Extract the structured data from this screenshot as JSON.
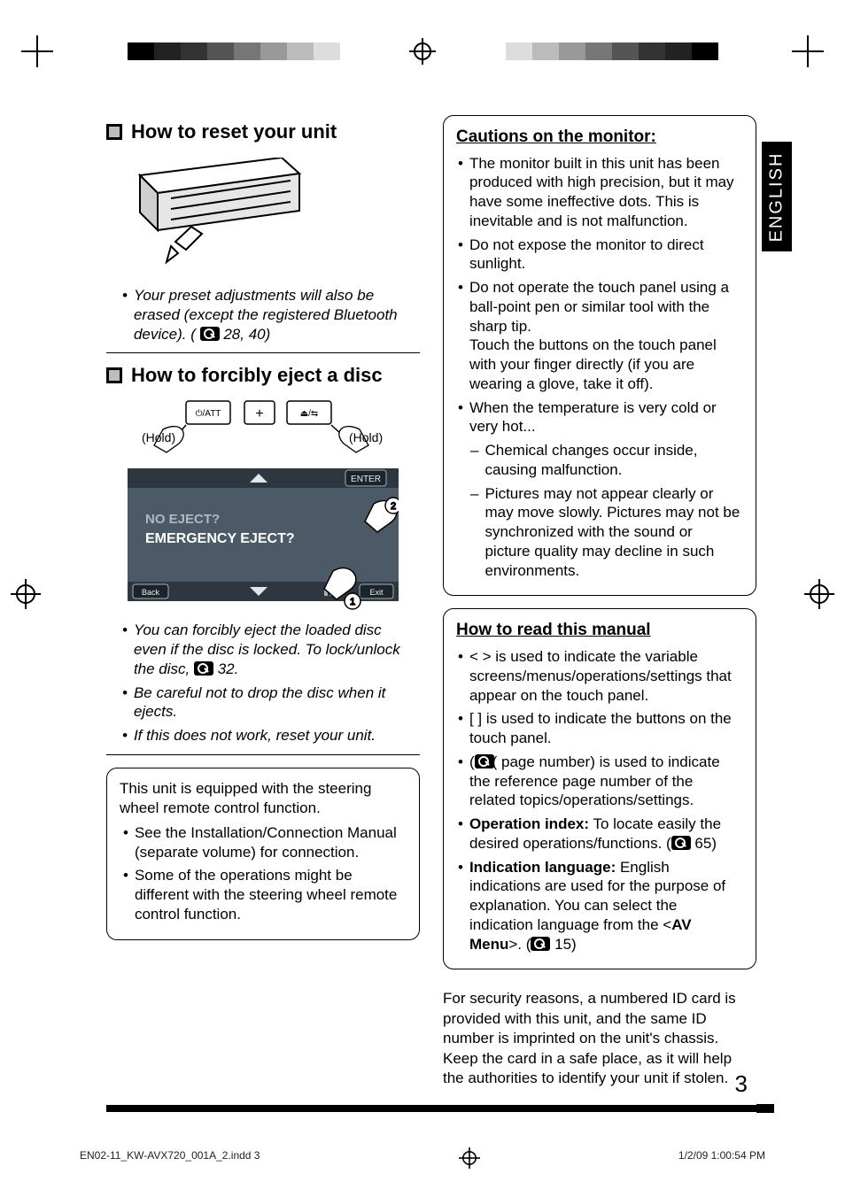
{
  "language_tab": "ENGLISH",
  "page_number": "3",
  "left": {
    "reset": {
      "title": "How to reset your unit",
      "note_before": "Your preset adjustments will also be erased (except the registered Bluetooth device). (",
      "note_pages": " 28, 40)"
    },
    "eject": {
      "title": "How to forcibly eject a disc",
      "hold": "(Hold)",
      "btn_att": "⏻/ATT",
      "btn_plus": "+",
      "btn_eject": "⏏/⇆",
      "screen_line1": "NO EJECT?",
      "screen_line2": "EMERGENCY EJECT?",
      "screen_back": "Back",
      "screen_exit": "Exit",
      "screen_enter": "ENTER",
      "notes": [
        "You can forcibly eject the loaded disc even if the disc is locked. To lock/unlock the disc,",
        "Be careful not to drop the disc when it ejects.",
        "If this does not work, reset your unit."
      ],
      "note0_tail": " 32."
    },
    "steering": {
      "lead": "This unit is equipped with the steering wheel remote control function.",
      "items": [
        "See the Installation/Connection Manual (separate volume) for connection.",
        "Some of the operations might be different with the steering wheel remote control function."
      ]
    }
  },
  "right": {
    "cautions": {
      "title": "Cautions on the monitor:",
      "items": [
        "The monitor built in this unit has been produced with high precision, but it may have some ineffective dots. This is inevitable and is not malfunction.",
        "Do not expose the monitor to direct sunlight.",
        "Do not operate the touch panel using a ball-point pen or similar tool with the sharp tip.\nTouch the buttons on the touch panel with your finger directly (if you are wearing a glove, take it off).",
        "When the temperature is very cold or very hot..."
      ],
      "sub": [
        "Chemical changes occur inside, causing malfunction.",
        "Pictures may not appear clearly or may move slowly. Pictures may not be synchronized with the sound or picture quality may decline in such environments."
      ]
    },
    "howto": {
      "title": "How to read this manual",
      "items": [
        "< > is used to indicate the variable screens/menus/operations/settings that appear on the touch panel.",
        "[ ] is used to indicate the buttons on the touch panel.",
        "(  page number) is used to indicate the reference page number of the related topics/operations/settings."
      ],
      "op_index_label": "Operation index:",
      "op_index_text": " To locate easily the desired operations/functions. (",
      "op_index_page": " 65)",
      "ind_lang_label": "Indication language:",
      "ind_lang_text": " English indications are used for the purpose of explanation. You can select the indication language from the <",
      "ind_lang_menu": "AV Menu",
      "ind_lang_tail": ">. (",
      "ind_lang_page": " 15)"
    },
    "security": "For security reasons, a numbered ID card is provided with this unit, and the same ID number is imprinted on the unit's chassis. Keep the card in a safe place, as it will help the authorities to identify your unit if stolen."
  },
  "slug": {
    "file": "EN02-11_KW-AVX720_001A_2.indd   3",
    "stamp": "1/2/09   1:00:54 PM"
  }
}
